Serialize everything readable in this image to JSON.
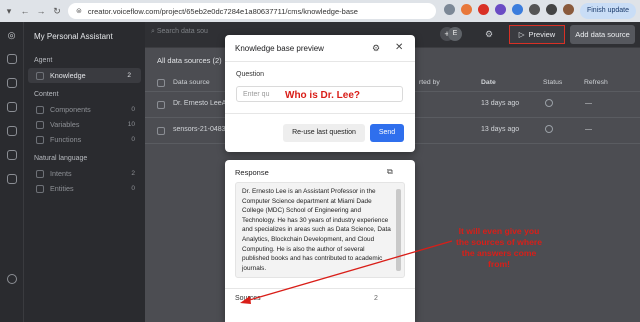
{
  "browser": {
    "url": "creator.voiceflow.com/project/65eb2e0dc7284e1a80637711/cms/knowledge-base",
    "finish_update": "Finish update"
  },
  "sidebar": {
    "project_title": "My Personal Assistant",
    "sections": [
      {
        "label": "Agent"
      },
      {
        "label": "Content"
      },
      {
        "label": "Natural language"
      }
    ],
    "items": [
      {
        "label": "Knowledge",
        "count": "2"
      },
      {
        "label": "Components",
        "count": "0"
      },
      {
        "label": "Variables",
        "count": "10"
      },
      {
        "label": "Functions",
        "count": "0"
      },
      {
        "label": "Intents",
        "count": "2"
      },
      {
        "label": "Entities",
        "count": "0"
      }
    ]
  },
  "topbar": {
    "search_placeholder": "Search data sou",
    "avatar_letter": "E",
    "plus": "+",
    "preview_label": "Preview",
    "add_data_label": "Add data source"
  },
  "main": {
    "heading": "All data sources (2)",
    "columns": [
      "Data source",
      "rted by",
      "Date",
      "Status",
      "Refresh"
    ],
    "rows": [
      {
        "name": "Dr. Ernesto LeeAI",
        "date": "13 days ago",
        "refresh": "—"
      },
      {
        "name": "sensors-21-04833",
        "date": "13 days ago",
        "refresh": "—"
      }
    ]
  },
  "modal": {
    "title": "Knowledge base preview",
    "question_label": "Question",
    "question_placeholder": "Enter qu",
    "reuse_label": "Re-use last question",
    "send_label": "Send"
  },
  "annotation_question": "Who is Dr. Lee?",
  "response": {
    "title": "Response",
    "text": "Dr. Ernesto Lee is an Assistant Professor in the Computer Science department at Miami Dade College (MDC) School of Engineering and Technology. He has 30 years of industry experience and specializes in areas such as Data Science, Data Analytics, Blockchain Development, and Cloud Computing. He is also the author of several published books and has contributed to academic journals.",
    "sources_label": "Sources",
    "sources_count": "2"
  },
  "annotation": "It will even give you the sources of where the answers come from!",
  "colors": {
    "accent_red": "#d91e18",
    "send_blue": "#2f6fed"
  }
}
